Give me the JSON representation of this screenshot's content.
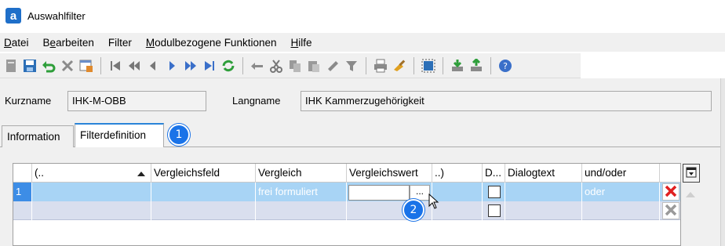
{
  "window": {
    "title": "Auswahlfilter",
    "app_icon_letter": "a"
  },
  "menu": [
    {
      "label": "Datei",
      "underline": "D",
      "rest": "atei"
    },
    {
      "label": "Bearbeiten",
      "pre": "B",
      "underline": "e",
      "rest": "arbeiten"
    },
    {
      "label": "Filter",
      "underline": "",
      "rest": "Filter"
    },
    {
      "label": "Modulbezogene Funktionen",
      "underline": "M",
      "rest": "odulbezogene Funktionen"
    },
    {
      "label": "Hilfe",
      "underline": "H",
      "rest": "ilfe"
    }
  ],
  "toolbar_icons": [
    "document-icon",
    "save-icon",
    "undo-icon",
    "delete-icon",
    "properties-icon",
    "first-record-icon",
    "previous-page-icon",
    "previous-record-icon",
    "next-record-icon",
    "next-page-icon",
    "last-record-icon",
    "refresh-icon",
    "back-arrow-icon",
    "cut-icon",
    "copy-icon",
    "paste-icon",
    "stamp-icon",
    "filter-icon",
    "print-icon",
    "clear-icon",
    "select-area-icon",
    "import-icon",
    "export-icon",
    "help-icon"
  ],
  "header": {
    "kurzname_label": "Kurzname",
    "kurzname_value": "IHK-M-OBB",
    "langname_label": "Langname",
    "langname_value": "IHK Kammerzugehörigkeit"
  },
  "tabs": [
    {
      "label": "Information",
      "active": false
    },
    {
      "label": "Filterdefinition",
      "active": true
    }
  ],
  "badges": {
    "one": "1",
    "two": "2"
  },
  "grid": {
    "columns": [
      "(..",
      "Vergleichsfeld",
      "Vergleich",
      "Vergleichswert",
      "..)",
      "D...",
      "Dialogtext",
      "und/oder"
    ],
    "rows": [
      {
        "num": "1",
        "open": "",
        "field": "",
        "compare": "frei formuliert",
        "value": "",
        "close": "",
        "dialog": "",
        "dialogtext": "",
        "andor": "oder"
      },
      {
        "num": "",
        "open": "",
        "field": "",
        "compare": "",
        "value": "",
        "close": "",
        "dialog": "",
        "dialogtext": "",
        "andor": ""
      }
    ],
    "ellipsis_label": "..."
  },
  "colors": {
    "selected_row": "#a8d4f5",
    "accent": "#1a73e8",
    "delete_red": "#e02020"
  }
}
